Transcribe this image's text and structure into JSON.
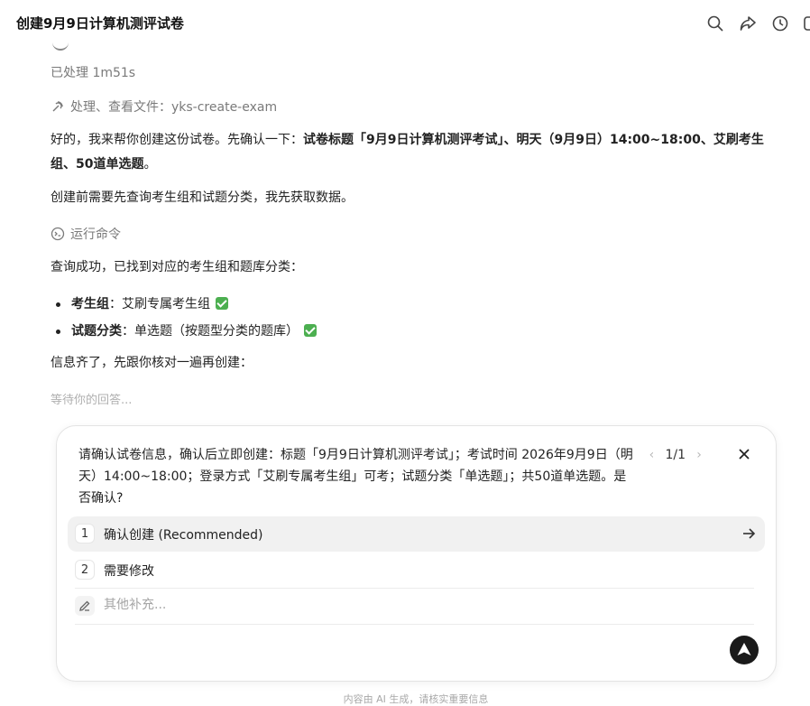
{
  "header": {
    "title": "创建9月9日计算机测评试卷",
    "icons": [
      "search-icon",
      "share-icon",
      "history-icon",
      "panel-icon"
    ]
  },
  "conversation": {
    "processed": "已处理 1m51s",
    "file_step": "处理、查看文件：yks-create-exam",
    "intro_plain": "好的，我来帮你创建这份试卷。先确认一下：",
    "intro_bold": "试卷标题「9月9日计算机测评考试」、明天（9月9日）14:00~18:00、艾刷考生组、50道单选题",
    "intro_end": "。",
    "need_query": "创建前需要先查询考生组和试题分类，我先获取数据。",
    "run_command": "运行命令",
    "query_success": "查询成功，已找到对应的考生组和题库分类：",
    "bullets": [
      {
        "key": "考生组",
        "sep": "：",
        "value": "艾刷专属考生组"
      },
      {
        "key": "试题分类",
        "sep": "：",
        "value": "单选题（按题型分类的题库）"
      }
    ],
    "info_ready": "信息齐了，先跟你核对一遍再创建：",
    "waiting": "等待你的回答..."
  },
  "question_card": {
    "question": "请确认试卷信息，确认后立即创建：标题「9月9日计算机测评考试」；考试时间 2026年9月9日（明天）14:00~18:00；登录方式「艾刷专属考生组」可考；试题分类「单选题」；共50道单选题。是否确认?",
    "pager": "1/1",
    "options": [
      {
        "num": "1",
        "label": "确认创建 (Recommended)"
      },
      {
        "num": "2",
        "label": "需要修改"
      }
    ],
    "other_placeholder": "其他补充..."
  },
  "footer": {
    "note": "内容由 AI 生成，请核实重要信息"
  }
}
